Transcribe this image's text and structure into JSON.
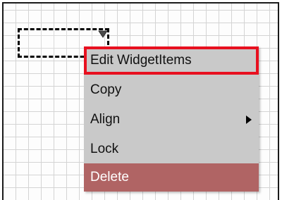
{
  "context_menu": {
    "items": [
      {
        "label": "Edit WidgetItems",
        "state": "highlighted"
      },
      {
        "label": "Copy"
      },
      {
        "label": "Align",
        "has_submenu": true
      },
      {
        "label": "Lock"
      },
      {
        "label": "Delete",
        "state": "danger"
      }
    ]
  },
  "icons": {
    "dropdown_handle": "triangle-down-icon",
    "submenu_arrow": "triangle-right-icon"
  },
  "colors": {
    "menu_background": "#c9c9c9",
    "highlight_border": "#e8101f",
    "delete_background": "#b06464",
    "grid_line": "#d4d4d4"
  }
}
